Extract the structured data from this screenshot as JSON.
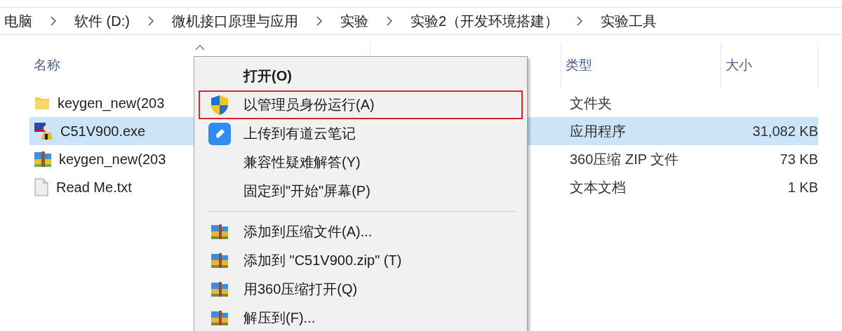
{
  "breadcrumb": [
    "电脑",
    "软件 (D:)",
    "微机接口原理与应用",
    "实验",
    "实验2（开发环境搭建）",
    "实验工具"
  ],
  "columns": [
    {
      "label": "名称",
      "sorted": true
    },
    {
      "label": "类型",
      "sorted": false
    },
    {
      "label": "大小",
      "sorted": false
    }
  ],
  "files": [
    {
      "name": "keygen_new(203",
      "kind": "folder",
      "type": "文件夹",
      "selected": false
    },
    {
      "name": "C51V900.exe",
      "kind": "exe",
      "type": "应用程序",
      "size": "31,082 KB",
      "selected": true
    },
    {
      "name": "keygen_new(203",
      "kind": "zip",
      "type": "360压缩 ZIP 文件",
      "size": "73 KB",
      "selected": false
    },
    {
      "name": "Read Me.txt",
      "kind": "txt",
      "type": "文本文档",
      "size": "1 KB",
      "selected": false
    }
  ],
  "context_menu": [
    {
      "kind": "plain",
      "label": "打开(O)",
      "default": true,
      "selected": false
    },
    {
      "kind": "admin",
      "label": "以管理员身份运行(A)",
      "default": false,
      "selected": true
    },
    {
      "kind": "note",
      "label": "上传到有道云笔记",
      "default": false,
      "selected": false
    },
    {
      "kind": "plain",
      "label": "兼容性疑难解答(Y)",
      "default": false,
      "selected": false
    },
    {
      "kind": "plain",
      "label": "固定到\"开始\"屏幕(P)",
      "default": false,
      "selected": false
    },
    {
      "kind": "separator"
    },
    {
      "kind": "archive",
      "label": "添加到压缩文件(A)...",
      "default": false,
      "selected": false
    },
    {
      "kind": "archive",
      "label": "添加到 \"C51V900.zip\" (T)",
      "default": false,
      "selected": false
    },
    {
      "kind": "archive",
      "label": "用360压缩打开(Q)",
      "default": false,
      "selected": false
    },
    {
      "kind": "archive",
      "label": "解压到(F)...",
      "default": false,
      "selected": false
    }
  ]
}
